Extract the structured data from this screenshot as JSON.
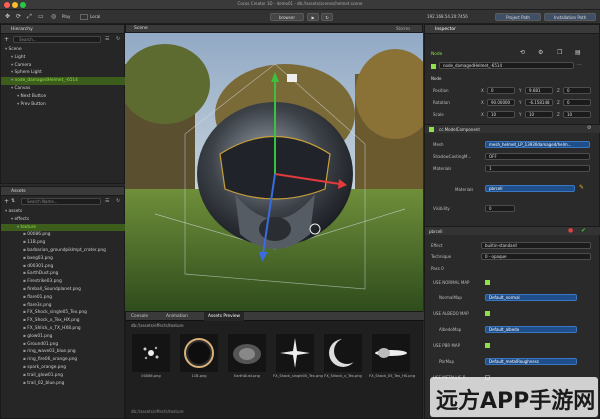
{
  "app": {
    "window_title": "Cocos Creator 3D - demo01 - db://assets/scenes/helmet.scene"
  },
  "toolbar": {
    "play": "Play",
    "local": "Local",
    "preview": "browser",
    "ip": "192.168.54.20:7456",
    "project_path": "Project Path",
    "install_path": "Installation Path"
  },
  "hierarchy": {
    "title": "Hierarchy",
    "search_placeholder": "Search...",
    "items": [
      {
        "label": "Scene",
        "indent": 0
      },
      {
        "label": "Light",
        "indent": 1
      },
      {
        "label": "Camera",
        "indent": 1
      },
      {
        "label": "Sphere Light",
        "indent": 1
      },
      {
        "label": "node_damagedHelmet_-6514",
        "indent": 1,
        "selected": true
      },
      {
        "label": "Canvas",
        "indent": 1
      },
      {
        "label": "Next Button",
        "indent": 2
      },
      {
        "label": "Prev Button",
        "indent": 2
      }
    ]
  },
  "assets": {
    "title": "Assets",
    "search_placeholder": "Search Name...",
    "items": [
      {
        "label": "assets",
        "indent": 0
      },
      {
        "label": "effects",
        "indent": 1
      },
      {
        "label": "texture",
        "indent": 2,
        "selected": true
      },
      {
        "label": "00086.png",
        "indent": 3
      },
      {
        "label": "11B.png",
        "indent": 3
      },
      {
        "label": "barbarian_groundpiklmpt_crater.png",
        "indent": 3
      },
      {
        "label": "bxeg03.png",
        "indent": 3
      },
      {
        "label": "d00301.png",
        "indent": 3
      },
      {
        "label": "EarthDust.png",
        "indent": 3
      },
      {
        "label": "Firestrike03.png",
        "indent": 3
      },
      {
        "label": "fireball_Soundplanet.png",
        "indent": 3
      },
      {
        "label": "flare01.png",
        "indent": 3
      },
      {
        "label": "flare3s.png",
        "indent": 3
      },
      {
        "label": "FX_Shock_single05_Tex.png",
        "indent": 3
      },
      {
        "label": "FX_Shock_x_Tex_HX.png",
        "indent": 3
      },
      {
        "label": "FX_Shlick_x_TX_HX8.png",
        "indent": 3
      },
      {
        "label": "glow01.png",
        "indent": 3
      },
      {
        "label": "Ground01.png",
        "indent": 3
      },
      {
        "label": "ring_wave03_blue.png",
        "indent": 3
      },
      {
        "label": "ring_fire06_orange.png",
        "indent": 3
      },
      {
        "label": "spark_orange.png",
        "indent": 3
      },
      {
        "label": "trail_glow01.png",
        "indent": 3
      },
      {
        "label": "trail_02_blue.png",
        "indent": 3
      }
    ]
  },
  "scene": {
    "title": "Scene",
    "views_label": "Storres"
  },
  "bottom": {
    "tabs": [
      "Console",
      "Animation",
      "Assets Preview"
    ],
    "path": "db://assets/effects/texture",
    "footer_path": "db://assets/effects/texture",
    "thumbs": [
      {
        "name": "00086.png",
        "kind": "dots"
      },
      {
        "name": "11B.png",
        "kind": "ring"
      },
      {
        "name": "EarthDust.png",
        "kind": "dust"
      },
      {
        "name": "FX_Shock_single05_Tex.png",
        "kind": "spark"
      },
      {
        "name": "FX_Shlock_x_Tex.png",
        "kind": "crescent"
      },
      {
        "name": "FX_Shock_05_Tex_HX.png",
        "kind": "streak"
      }
    ]
  },
  "inspector": {
    "title": "Inspector",
    "node_label": "Node",
    "node_name": "node_damagedHelmet_-6514",
    "node_section": "Node",
    "position": {
      "label": "Position",
      "x": "0",
      "y": "9.681",
      "z": "0"
    },
    "rotation": {
      "label": "Rotation",
      "x": "90.00000",
      "y": "-6.158148",
      "z": "0"
    },
    "scale": {
      "label": "Scale",
      "x": "10",
      "y": "10",
      "z": "10"
    },
    "component": "cc.ModelComponent",
    "mesh_label": "Mesh",
    "mesh_value": "mesh_helmet_LP_13930damaged/helm...",
    "shadow_label": "ShadowCastingM...",
    "shadow_value": "OFF",
    "materials_label": "Materials",
    "materials_count": "1",
    "material_label": "Materials",
    "material_value": "pbrcell",
    "visibility_label": "Visibility",
    "visibility_value": "0",
    "material_name": "pbrcell",
    "effect_label": "Effect",
    "effect_value": "builtin-standard",
    "technique_label": "Technique",
    "technique_value": "0 - opaque",
    "pass_label": "Pass 0",
    "use_normal": "USE NORMAL MAP",
    "normal_label": "NormalMap",
    "normal_value": "Default_normal",
    "use_albedo": "USE ALBEDO MAP",
    "albedo_label": "AlbedoMap",
    "albedo_value": "Default_albedo",
    "use_pbr": "USE PBR MAP",
    "pbr_label": "PbrMap",
    "pbr_value": "Default_metalRoughness",
    "use_metallic": "USE METALLIC R...",
    "xyz": [
      "X",
      "Y",
      "Z"
    ]
  },
  "watermark": "远方APP手游网",
  "colors": {
    "accent": "#3a77c0",
    "selection_green": "#8fe04a",
    "panel_bg": "#262626"
  }
}
